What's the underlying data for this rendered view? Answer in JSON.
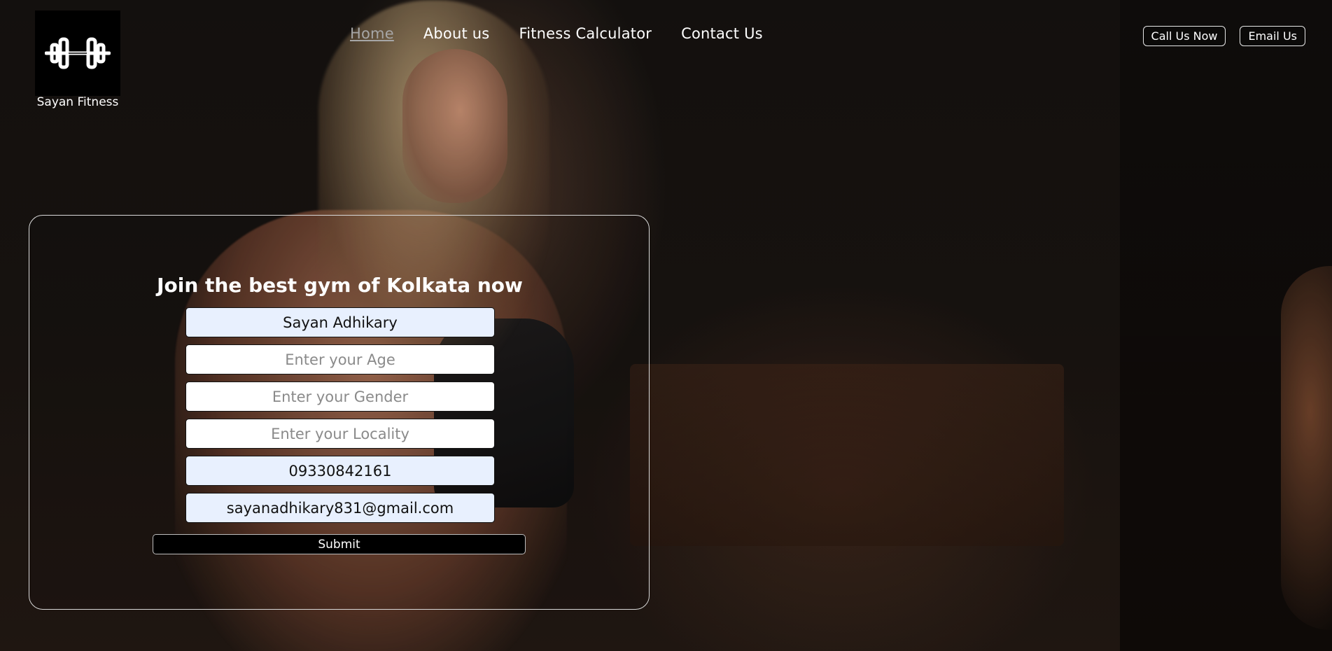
{
  "brand": {
    "name": "Sayan Fitness",
    "logo_icon": "dumbbell-icon"
  },
  "nav": {
    "items": [
      {
        "label": "Home",
        "active": true
      },
      {
        "label": "About us",
        "active": false
      },
      {
        "label": "Fitness Calculator",
        "active": false
      },
      {
        "label": "Contact Us",
        "active": false
      }
    ]
  },
  "actions": {
    "call_label": "Call Us Now",
    "email_label": "Email Us"
  },
  "form": {
    "title": "Join the best gym of Kolkata now",
    "fields": [
      {
        "value": "Sayan Adhikary",
        "placeholder": ""
      },
      {
        "value": "",
        "placeholder": "Enter your Age"
      },
      {
        "value": "",
        "placeholder": "Enter your Gender"
      },
      {
        "value": "",
        "placeholder": "Enter your Locality"
      },
      {
        "value": "09330842161",
        "placeholder": ""
      },
      {
        "value": "sayanadhikary831@gmail.com",
        "placeholder": ""
      }
    ],
    "submit_label": "Submit"
  },
  "colors": {
    "autofill_bg": "#e8f0fe",
    "nav_active": "#a6a6a6",
    "card_border": "#d9d9d9"
  }
}
